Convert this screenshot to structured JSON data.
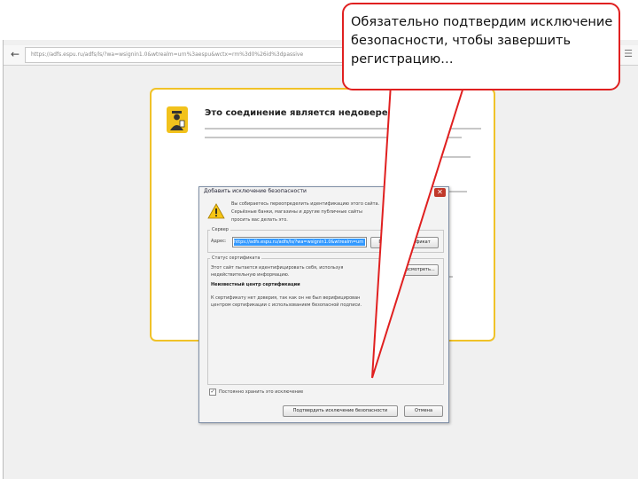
{
  "browser": {
    "url": "https://adfs.espu.ru/adfs/ls/?wa=wsignin1.0&wtrealm=urn%3aespu&wctx=rm%3d0%26id%3dpassive"
  },
  "page": {
    "title": "Это соединение является недоверенным"
  },
  "dialog": {
    "title": "Добавить исключение безопасности",
    "warning_lines": [
      "Вы собираетесь переопределить идентификацию этого сайта.",
      "Серьёзные банки, магазины и другие публичные сайты",
      "просить вас делать это."
    ],
    "server_label": "Сервер",
    "address_label": "Адрес:",
    "address_value": "https://adfs.espu.ru/adfs/ls/?wa=wsignin1.0&wtrealm=urn",
    "get_cert_label": "Получить сертификат",
    "cert_status_label": "Статус сертификата",
    "cert_status_lines": [
      "Этот сайт пытается идентифицировать себя, используя",
      "недействительную информацию."
    ],
    "view_label": "Просмотреть...",
    "unknown_ca": "Неизвестный центр сертификации",
    "trust_lines": [
      "К сертификату нет доверия, так как он не был верифицирован",
      "центром сертификации с использованием безопасной подписи."
    ],
    "permanent_label": "Постоянно хранить это исключение",
    "confirm_label": "Подтвердить исключение безопасности",
    "cancel_label": "Отмена"
  },
  "callout": {
    "text": "Обязательно подтвердим исключение безопасности, чтобы завершить регистрацию…"
  }
}
